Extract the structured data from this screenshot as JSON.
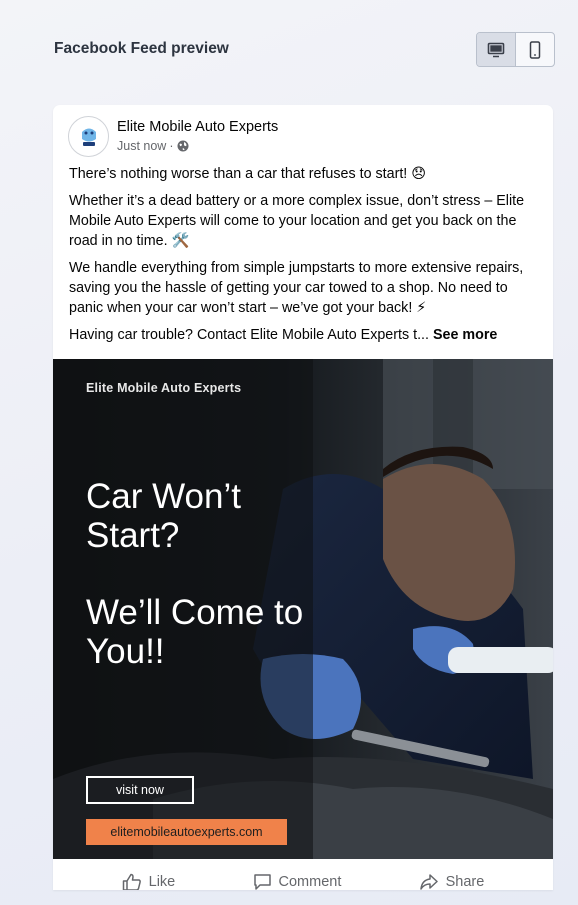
{
  "header": {
    "title": "Facebook Feed preview",
    "view_options": [
      {
        "label": "",
        "icon": "desktop-icon",
        "active": true
      },
      {
        "label": "",
        "icon": "mobile-icon",
        "active": false
      }
    ]
  },
  "post": {
    "page_name": "Elite Mobile Auto Experts",
    "timestamp": "Just now",
    "audience_icon": "globe-icon",
    "paragraphs": [
      "There’s nothing worse than a car that refuses to start! 😞",
      "Whether it’s a dead battery or a more complex issue, don’t stress – Elite Mobile Auto Experts will come to your location and get you back on the road in no time. 🛠️",
      "We handle everything from simple jumpstarts to more extensive repairs, saving you the hassle of getting your car towed to a shop. No need to panic when your car won’t start – we’ve got your back! ⚡"
    ],
    "truncated_text": "Having car trouble? Contact Elite Mobile Auto Experts t...",
    "see_more_label": "See more"
  },
  "ad": {
    "brand": "Elite Mobile Auto Experts",
    "headline_1": "Car Won’t Start?",
    "headline_2": "We’ll Come to You!!",
    "cta_label": "visit now",
    "url": "elitemobileautoexperts.com",
    "accent_color": "#f0824a"
  },
  "actions": {
    "like": "Like",
    "comment": "Comment",
    "share": "Share"
  }
}
